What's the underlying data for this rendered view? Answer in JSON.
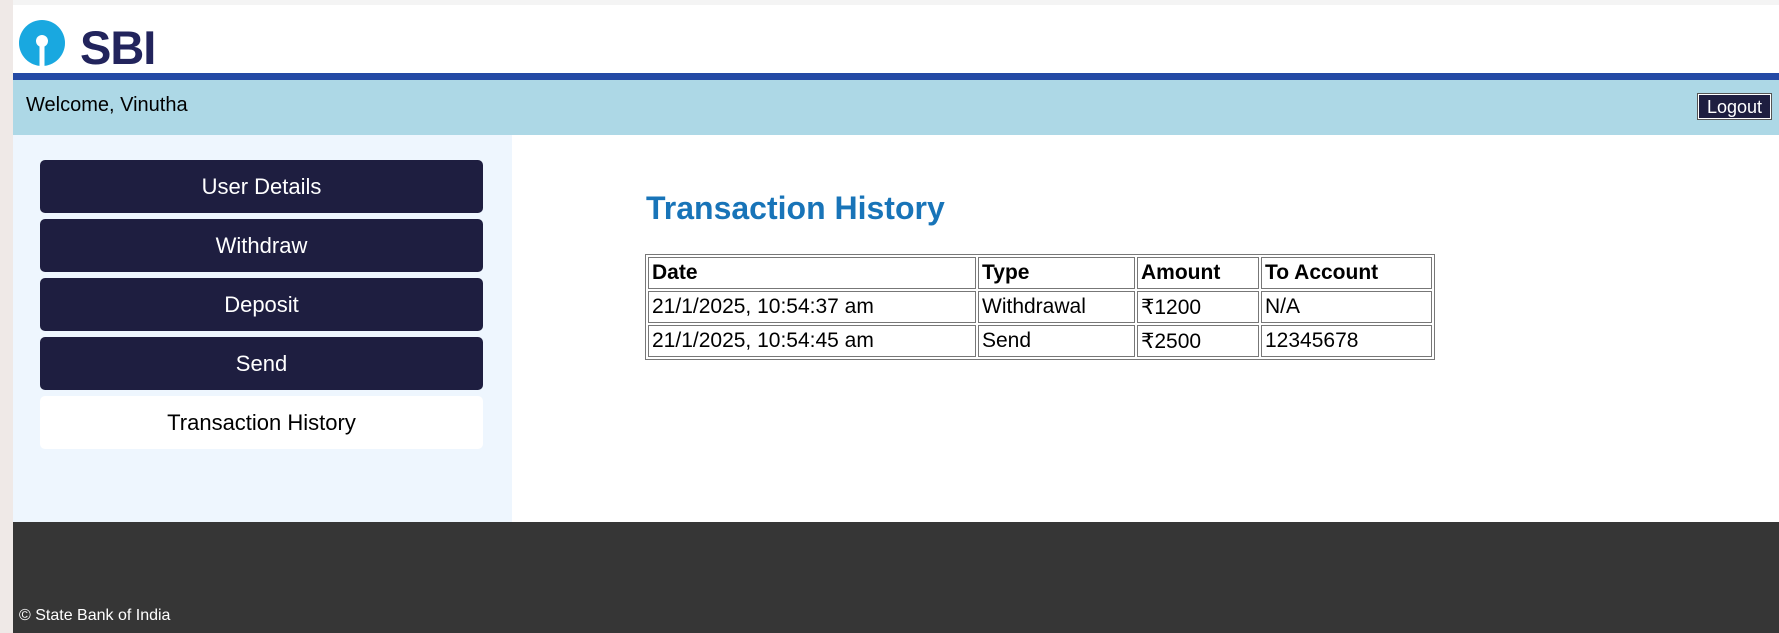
{
  "brand": {
    "name": "SBI",
    "logo_color": "#19a8e0",
    "text_color": "#22245c"
  },
  "header": {
    "welcome_text": "Welcome, Vinutha",
    "logout_label": "Logout",
    "bar_color": "#add8e6",
    "accent_line_color": "#244aa5"
  },
  "sidebar": {
    "items": [
      {
        "label": "User Details",
        "active": false
      },
      {
        "label": "Withdraw",
        "active": false
      },
      {
        "label": "Deposit",
        "active": false
      },
      {
        "label": "Send",
        "active": false
      },
      {
        "label": "Transaction History",
        "active": true
      }
    ]
  },
  "main": {
    "title": "Transaction History",
    "table": {
      "columns": [
        "Date",
        "Type",
        "Amount",
        "To Account"
      ],
      "rows": [
        [
          "21/1/2025, 10:54:37 am",
          "Withdrawal",
          "₹1200",
          "N/A"
        ],
        [
          "21/1/2025, 10:54:45 am",
          "Send",
          "₹2500",
          "12345678"
        ]
      ]
    }
  },
  "footer": {
    "copyright": "© State Bank of India"
  }
}
